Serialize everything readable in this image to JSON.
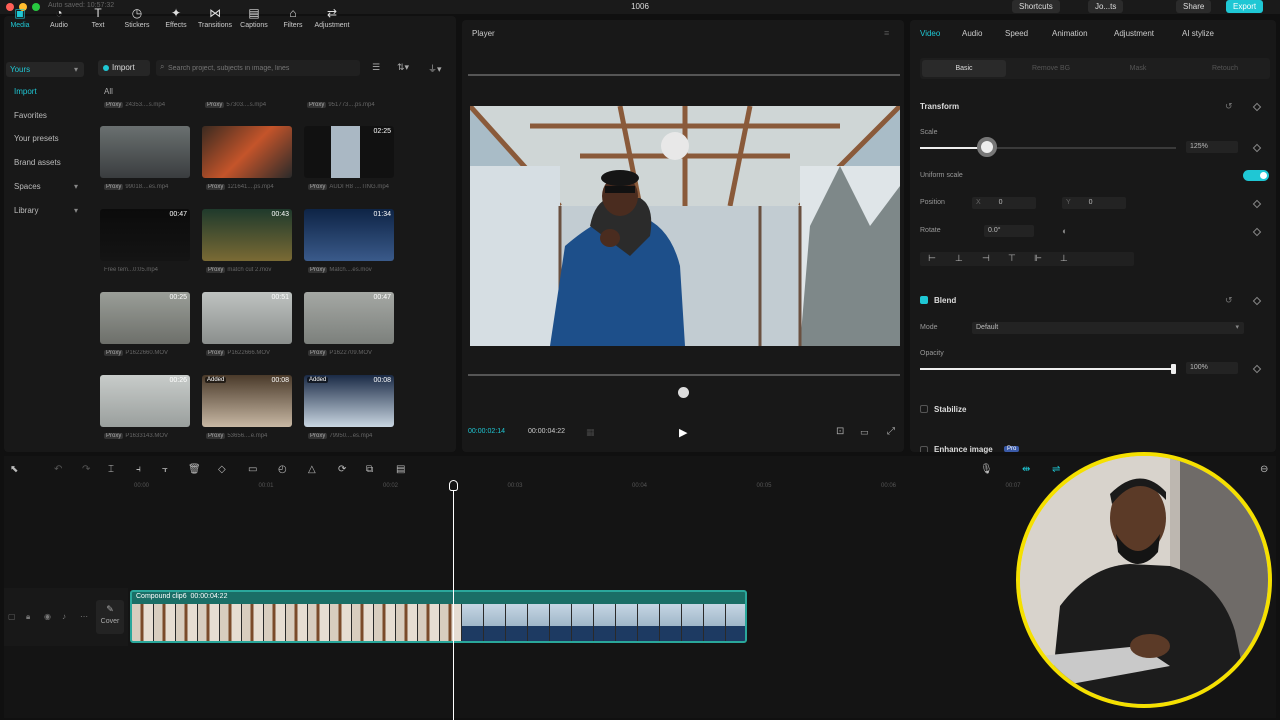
{
  "titlebar": {
    "autosave": "Auto saved: 10:57:32",
    "title": "1006",
    "shortcuts": "Shortcuts",
    "user": "Jo...ts",
    "share": "Share",
    "export": "Export"
  },
  "toolbar": [
    {
      "label": "Media",
      "icon": "media-icon"
    },
    {
      "label": "Audio",
      "icon": "audio-icon"
    },
    {
      "label": "Text",
      "icon": "text-icon"
    },
    {
      "label": "Stickers",
      "icon": "stickers-icon"
    },
    {
      "label": "Effects",
      "icon": "effects-icon"
    },
    {
      "label": "Transitions",
      "icon": "transitions-icon"
    },
    {
      "label": "Captions",
      "icon": "captions-icon"
    },
    {
      "label": "Filters",
      "icon": "filters-icon"
    },
    {
      "label": "Adjustment",
      "icon": "adjustment-icon"
    }
  ],
  "sidebar": {
    "yours": "Yours",
    "import": "Import",
    "favorites": "Favorites",
    "presets": "Your presets",
    "brand": "Brand assets",
    "spaces": "Spaces",
    "library": "Library"
  },
  "media": {
    "import_label": "Import",
    "search_placeholder": "Search project, subjects in image, lines",
    "all_label": "All",
    "top_caps": [
      "24353....s.mp4",
      "57303....s.mp4",
      "951773....ps.mp4"
    ],
    "items": [
      {
        "dur": "",
        "cap": "99018....es.mp4",
        "badge": ""
      },
      {
        "dur": "",
        "cap": "121641....ps.mp4",
        "badge": ""
      },
      {
        "dur": "02:25",
        "cap": "AUDI R8 ....TING.mp4",
        "badge": ""
      },
      {
        "dur": "00:47",
        "cap": "Free tem...0:05.mp4",
        "badge": ""
      },
      {
        "dur": "00:43",
        "cap": "match cut 2.mov",
        "badge": ""
      },
      {
        "dur": "01:34",
        "cap": "Match....es.mov",
        "badge": ""
      },
      {
        "dur": "00:25",
        "cap": "P1622660.MOV",
        "badge": ""
      },
      {
        "dur": "00:51",
        "cap": "P1622666.MOV",
        "badge": ""
      },
      {
        "dur": "00:47",
        "cap": "P1622709.MOV",
        "badge": ""
      },
      {
        "dur": "00:26",
        "cap": "P1633143.MOV",
        "badge": ""
      },
      {
        "dur": "00:08",
        "cap": "53656....e.mp4",
        "badge": "Added"
      },
      {
        "dur": "00:08",
        "cap": "79950....es.mp4",
        "badge": "Added"
      }
    ]
  },
  "player": {
    "title": "Player",
    "time_current": "00:00:02:14",
    "time_total": "00:00:04:22"
  },
  "inspector": {
    "tabs": [
      "Video",
      "Audio",
      "Speed",
      "Animation",
      "Adjustment",
      "AI stylize"
    ],
    "subtabs": [
      "Basic",
      "Remove BG",
      "Mask",
      "Retouch"
    ],
    "transform": "Transform",
    "scale_label": "Scale",
    "scale_value": "125%",
    "scale_fraction": 0.26,
    "uniform_scale": "Uniform scale",
    "position_label": "Position",
    "pos_x_label": "X",
    "pos_x": "0",
    "pos_y_label": "Y",
    "pos_y": "0",
    "rotate_label": "Rotate",
    "rotate_value": "0.0°",
    "blend": "Blend",
    "mode_label": "Mode",
    "mode_value": "Default",
    "opacity_label": "Opacity",
    "opacity_value": "100%",
    "opacity_fraction": 1.0,
    "stabilize": "Stabilize",
    "enhance": "Enhance image",
    "enhance_badge": "Pro"
  },
  "timeline": {
    "ruler": [
      "00:00",
      "00:01",
      "00:02",
      "00:03",
      "00:04",
      "00:05",
      "00:06",
      "00:07"
    ],
    "clip_name": "Compound clip6",
    "clip_duration": "00:00:04:22",
    "cover_label": "Cover"
  },
  "colors": {
    "accent": "#1fc7d4",
    "clip": "#2aa79b",
    "webcam_ring": "#f5e000"
  }
}
